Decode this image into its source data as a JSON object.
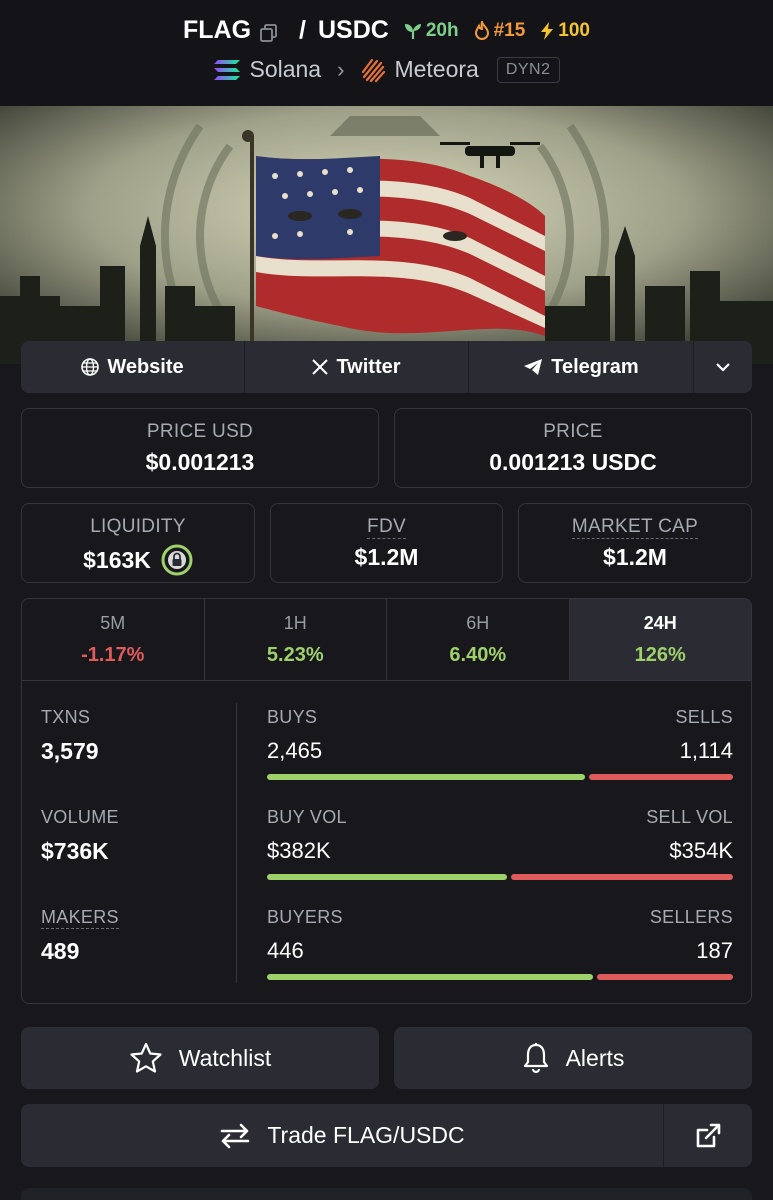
{
  "header": {
    "token": "FLAG",
    "quote": "USDC",
    "age": "20h",
    "rank": "#15",
    "boost": "100",
    "chain": "Solana",
    "dex": "Meteora",
    "pool_tag": "DYN2"
  },
  "links": {
    "website": "Website",
    "twitter": "Twitter",
    "telegram": "Telegram"
  },
  "prices": {
    "usd_label": "PRICE USD",
    "usd_value": "$0.001213",
    "native_label": "PRICE",
    "native_value": "0.001213 USDC"
  },
  "metrics": {
    "liquidity_label": "LIQUIDITY",
    "liquidity_value": "$163K",
    "fdv_label": "FDV",
    "fdv_value": "$1.2M",
    "mcap_label": "MARKET CAP",
    "mcap_value": "$1.2M"
  },
  "timeframes": [
    {
      "label": "5M",
      "change": "-1.17%"
    },
    {
      "label": "1H",
      "change": "5.23%"
    },
    {
      "label": "6H",
      "change": "6.40%"
    },
    {
      "label": "24H",
      "change": "126%"
    }
  ],
  "selected_timeframe": "24H",
  "stats": {
    "txns_label": "TXNS",
    "txns_value": "3,579",
    "volume_label": "VOLUME",
    "volume_value": "$736K",
    "makers_label": "MAKERS",
    "makers_value": "489",
    "buys_label": "BUYS",
    "buys_value": "2,465",
    "sells_label": "SELLS",
    "sells_value": "1,114",
    "buy_vol_label": "BUY VOL",
    "buy_vol_value": "$382K",
    "sell_vol_label": "SELL VOL",
    "sell_vol_value": "$354K",
    "buyers_label": "BUYERS",
    "buyers_value": "446",
    "sellers_label": "SELLERS",
    "sellers_value": "187"
  },
  "ratios": {
    "buys_share": 0.689,
    "buy_vol_share": 0.519,
    "buyers_share": 0.705
  },
  "actions": {
    "watchlist": "Watchlist",
    "alerts": "Alerts",
    "trade": "Trade FLAG/USDC"
  },
  "colors": {
    "positive": "#9fd16a",
    "negative": "#e05b5b",
    "age_badge": "#7cd08a",
    "rank_badge": "#f29a3a",
    "boost_badge": "#f4c430"
  },
  "icons": [
    "copy-icon",
    "seedling-icon",
    "flame-icon",
    "bolt-icon",
    "solana-icon",
    "meteora-icon",
    "globe-icon",
    "x-icon",
    "telegram-icon",
    "chevron-down-icon",
    "lock-icon",
    "star-icon",
    "bell-icon",
    "swap-icon",
    "external-link-icon"
  ]
}
